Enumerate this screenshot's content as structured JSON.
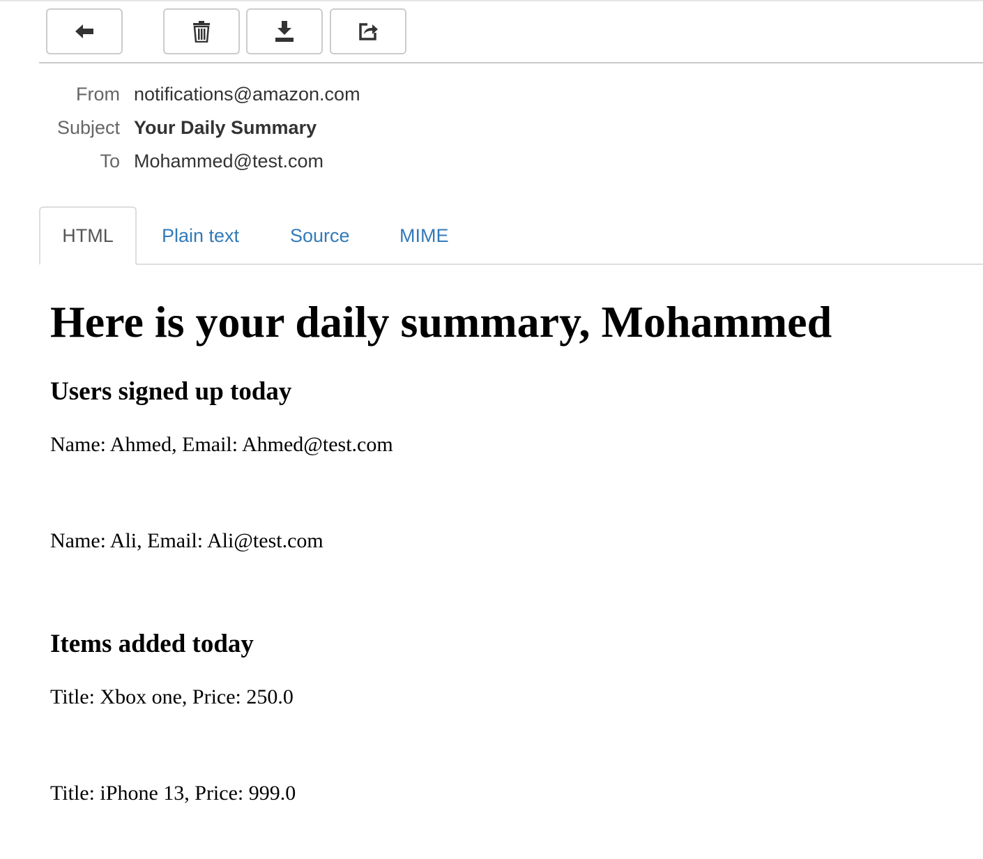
{
  "toolbar": {
    "buttons": [
      {
        "icon": "arrow-left-icon"
      },
      {
        "icon": "trash-icon"
      },
      {
        "icon": "download-icon"
      },
      {
        "icon": "share-icon"
      }
    ]
  },
  "headers": {
    "from_label": "From",
    "from_value": "notifications@amazon.com",
    "subject_label": "Subject",
    "subject_value": "Your Daily Summary",
    "to_label": "To",
    "to_value": "Mohammed@test.com"
  },
  "tabs": [
    {
      "label": "HTML",
      "active": true
    },
    {
      "label": "Plain text",
      "active": false
    },
    {
      "label": "Source",
      "active": false
    },
    {
      "label": "MIME",
      "active": false
    }
  ],
  "message": {
    "title": "Here is your daily summary, Mohammed",
    "users_heading": "Users signed up today",
    "users": [
      "Name: Ahmed, Email: Ahmed@test.com",
      "Name: Ali, Email: Ali@test.com"
    ],
    "items_heading": "Items added today",
    "items": [
      "Title: Xbox one, Price: 250.0",
      "Title: iPhone 13, Price: 999.0"
    ]
  },
  "colors": {
    "link": "#337ab7",
    "label": "#666666",
    "text": "#333333",
    "border": "#cccccc"
  }
}
